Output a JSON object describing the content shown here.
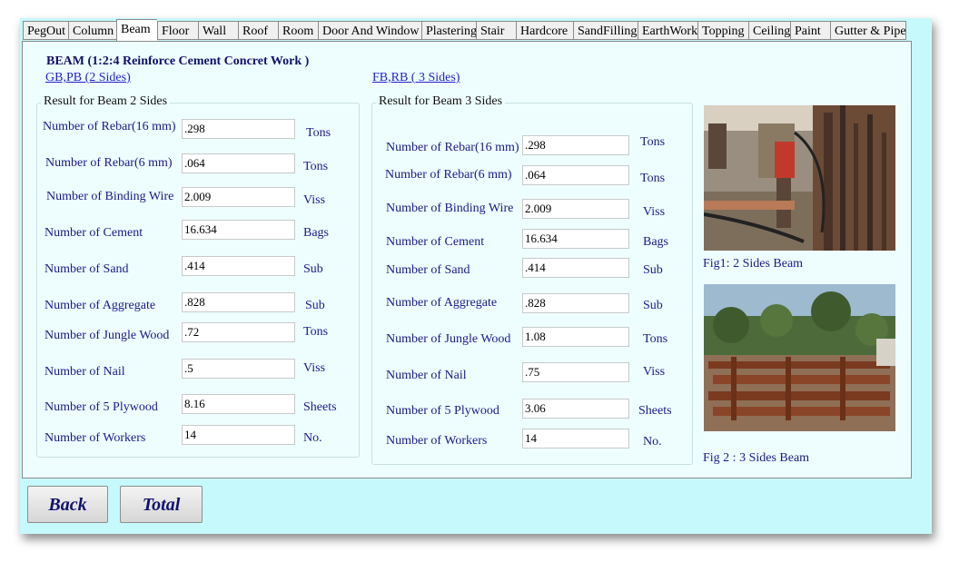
{
  "tabs": [
    "PegOut",
    "Column",
    "Beam",
    "Floor",
    "Wall",
    "Roof",
    "Room",
    "Door And Window",
    "Plastering",
    "Stair",
    "Hardcore",
    "SandFilling",
    "EarthWork",
    "Topping",
    "Ceiling",
    "Paint",
    "Gutter & Pipe"
  ],
  "active_tab": "Beam",
  "title": "BEAM  (1:2:4 Reinforce Cement Concret Work )",
  "link_left": "GB,PB (2 Sides)",
  "link_right": "FB,RB ( 3 Sides)",
  "group2": {
    "legend": "Result for Beam 2 Sides",
    "rows": [
      {
        "label": "Number of Rebar(16 mm)",
        "value": ".298",
        "unit": "Tons"
      },
      {
        "label": "Number of Rebar(6 mm)",
        "value": ".064",
        "unit": "Tons"
      },
      {
        "label": "Number of Binding Wire",
        "value": "2.009",
        "unit": "Viss"
      },
      {
        "label": "Number of Cement",
        "value": "16.634",
        "unit": "Bags"
      },
      {
        "label": "Number of Sand",
        "value": ".414",
        "unit": "Sub"
      },
      {
        "label": "Number of Aggregate",
        "value": ".828",
        "unit": "Sub"
      },
      {
        "label": "Number of Jungle Wood",
        "value": ".72",
        "unit": "Tons"
      },
      {
        "label": "Number of Nail",
        "value": ".5",
        "unit": "Viss"
      },
      {
        "label": "Number of 5 Plywood",
        "value": "8.16",
        "unit": "Sheets"
      },
      {
        "label": "Number of Workers",
        "value": "14",
        "unit": "No."
      }
    ]
  },
  "group3": {
    "legend": "Result for Beam 3 Sides",
    "rows": [
      {
        "label": "Number of Rebar(16 mm)",
        "value": ".298",
        "unit": "Tons"
      },
      {
        "label": "Number of Rebar(6 mm)",
        "value": ".064",
        "unit": "Tons"
      },
      {
        "label": "Number of Binding Wire",
        "value": "2.009",
        "unit": "Viss"
      },
      {
        "label": "Number of Cement",
        "value": "16.634",
        "unit": "Bags"
      },
      {
        "label": "Number of Sand",
        "value": ".414",
        "unit": "Sub"
      },
      {
        "label": "Number of Aggregate",
        "value": ".828",
        "unit": "Sub"
      },
      {
        "label": "Number of Jungle Wood",
        "value": "1.08",
        "unit": "Tons"
      },
      {
        "label": "Number of Nail",
        "value": ".75",
        "unit": "Viss"
      },
      {
        "label": "Number of 5 Plywood",
        "value": "3.06",
        "unit": "Sheets"
      },
      {
        "label": "Number of Workers",
        "value": "14",
        "unit": "No."
      }
    ]
  },
  "fig1_caption": "Fig1: 2 Sides Beam",
  "fig2_caption": "Fig 2 : 3 Sides Beam",
  "buttons": {
    "back": "Back",
    "total": "Total"
  },
  "colors": {
    "window_bg": "#c6f9fb",
    "panel_bg": "#eefefe",
    "label_text": "#1a1a8a",
    "link": "#1f1fd0"
  }
}
